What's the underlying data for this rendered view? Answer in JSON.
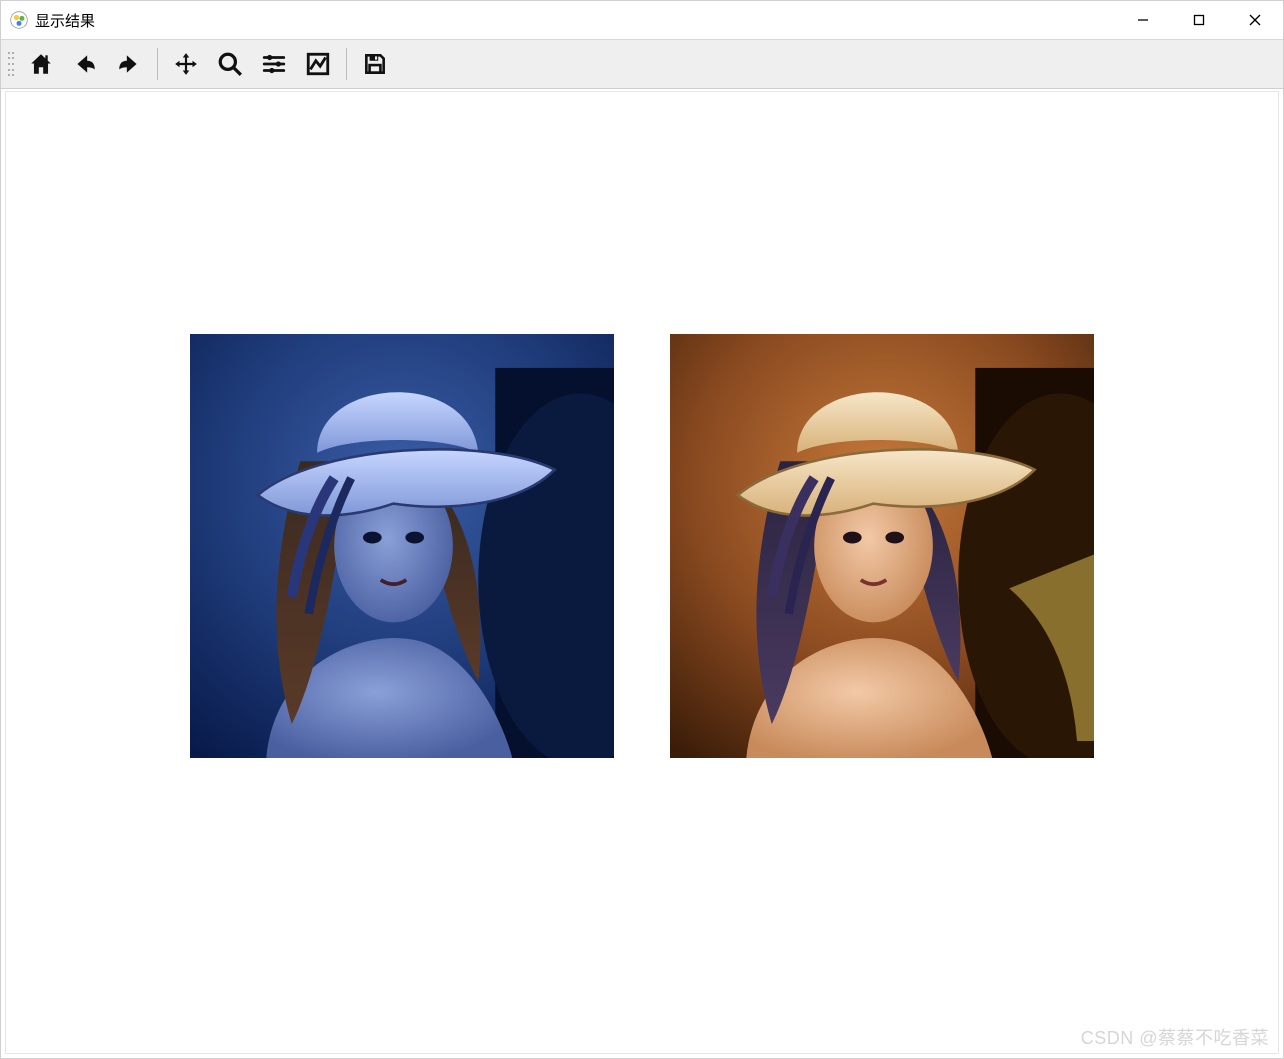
{
  "window": {
    "title": "显示结果"
  },
  "toolbar": {
    "home": "Home",
    "back": "Back",
    "forward": "Forward",
    "pan": "Pan",
    "zoom": "Zoom",
    "subplots": "Configure subplots",
    "axes": "Edit axis",
    "save": "Save"
  },
  "figure": {
    "panels": [
      {
        "name": "left-image",
        "tint": "blue"
      },
      {
        "name": "right-image",
        "tint": "warm"
      }
    ]
  },
  "watermark": "CSDN @蔡蔡不吃香菜"
}
